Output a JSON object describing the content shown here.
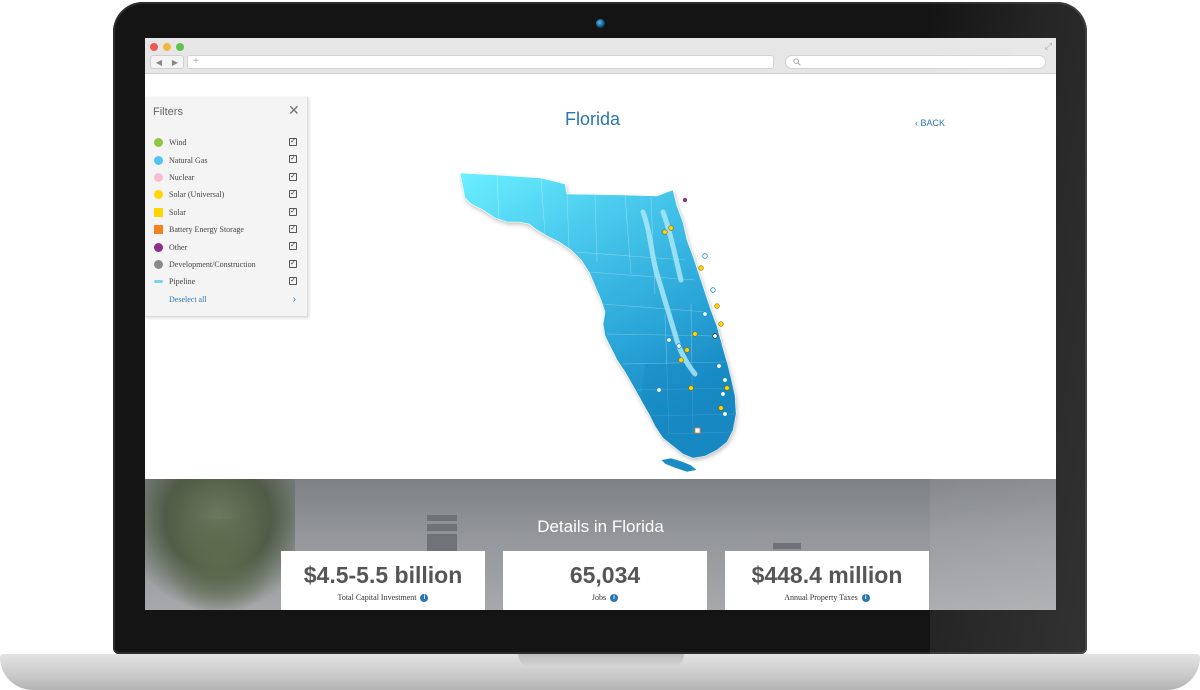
{
  "colors": {
    "accent": "#2a76b0",
    "map_light": "#5ee6ff",
    "map_dark": "#1a8cc4"
  },
  "browser": {
    "nav_back_icon": "triangle-left-icon",
    "nav_forward_icon": "triangle-right-icon",
    "address_plus": "+",
    "search_icon": "magnifier-icon"
  },
  "filters": {
    "title": "Filters",
    "close_icon": "close-icon",
    "items": [
      {
        "label": "Wind",
        "color": "#8dc63f",
        "shape": "circle"
      },
      {
        "label": "Natural Gas",
        "color": "#4fc3f7",
        "shape": "circle"
      },
      {
        "label": "Nuclear",
        "color": "#f8bbd0",
        "shape": "circle"
      },
      {
        "label": "Solar (Universal)",
        "color": "#ffd600",
        "shape": "circle"
      },
      {
        "label": "Solar",
        "color": "#ffd600",
        "shape": "square"
      },
      {
        "label": "Battery Energy Storage",
        "color": "#f58220",
        "shape": "square"
      },
      {
        "label": "Other",
        "color": "#8e2c8e",
        "shape": "circle"
      },
      {
        "label": "Development/Construction",
        "color": "#8a8a8a",
        "shape": "circle"
      },
      {
        "label": "Pipeline",
        "color": "#7ad3ec",
        "shape": "line"
      }
    ],
    "deselect_all": "Deselect all"
  },
  "map": {
    "title": "Florida",
    "back": "‹ BACK"
  },
  "details": {
    "title": "Details in Florida",
    "stats": [
      {
        "value": "$4.5-5.5 billion",
        "label": "Total Capital Investment"
      },
      {
        "value": "65,034",
        "label": "Jobs"
      },
      {
        "value": "$448.4 million",
        "label": "Annual Property Taxes"
      }
    ]
  }
}
